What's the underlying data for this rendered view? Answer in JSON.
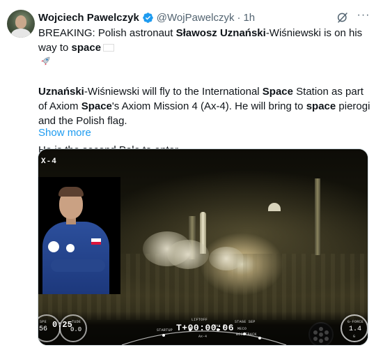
{
  "author": {
    "display_name": "Wojciech Pawelczyk",
    "handle": "@WojPawelczyk",
    "separator": "·",
    "time": "1h",
    "verified_icon": "verified-badge-icon",
    "avatar_icon": "avatar"
  },
  "actions": {
    "grok_icon": "grok-icon",
    "more_label": "···"
  },
  "tweet": {
    "p1_a": "BREAKING: Polish astronaut ",
    "p1_b": "Sławosz Uznański",
    "p1_c": "-Wiśniewski is on his way to ",
    "p1_d": "space",
    "p2_a": "Uznański",
    "p2_b": "-Wiśniewski will fly to the International ",
    "p2_c": "Space",
    "p2_d": " Station as part of Axiom ",
    "p2_e": "Space",
    "p2_f": "'s Axiom Mission 4 (Ax-4). He will bring to ",
    "p2_g": "space",
    "p2_h": " pierogi and the Polish flag.",
    "p3": "He is the second Pole to enter",
    "show_more": "Show more"
  },
  "media": {
    "mission_label": "X-4",
    "hud": {
      "left_tag_1": "SPE",
      "left_val_1": "56",
      "left_tag_2": "TUDE",
      "left_val_2": "0.0",
      "left_big": "0:25",
      "arc_tags": [
        "STARTUP",
        "LIFTOFF",
        "MAX Q",
        "STAGE SEP",
        "MECO",
        "BOOSTBACK"
      ],
      "timer": "T+00:00:06",
      "sub": "Ax-4",
      "gforce_tag": "G-FORCE",
      "gforce_val": "1.4",
      "gforce_unit": "G"
    }
  },
  "colors": {
    "link": "#1d9bf0",
    "text": "#0f1419",
    "muted": "#536471",
    "verified": "#1d9bf0"
  }
}
